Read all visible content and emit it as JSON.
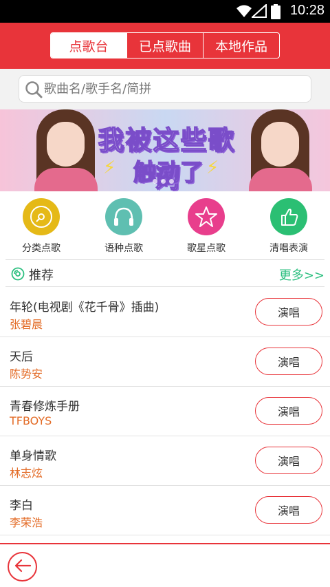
{
  "status_bar": {
    "time": "10:28"
  },
  "header": {
    "tabs": [
      {
        "label": "点歌台",
        "active": true
      },
      {
        "label": "已点歌曲",
        "active": false
      },
      {
        "label": "本地作品",
        "active": false
      }
    ]
  },
  "search": {
    "placeholder": "歌曲名/歌手名/简拼"
  },
  "banner": {
    "line1": "我被这些歌词",
    "line2": "触动了"
  },
  "categories": [
    {
      "label": "分类点歌",
      "icon": "disc-icon",
      "color": "#e5b917"
    },
    {
      "label": "语种点歌",
      "icon": "headphones-icon",
      "color": "#5fbfb1"
    },
    {
      "label": "歌星点歌",
      "icon": "star-icon",
      "color": "#e83e8c"
    },
    {
      "label": "清唱表演",
      "icon": "thumbs-up-icon",
      "color": "#2bbf73"
    }
  ],
  "recommend": {
    "title": "推荐",
    "more": "更多>>"
  },
  "songs": [
    {
      "title": "年轮(电视剧《花千骨》插曲)",
      "artist": "张碧晨",
      "button": "演唱"
    },
    {
      "title": "天后",
      "artist": "陈势安",
      "button": "演唱"
    },
    {
      "title": "青春修炼手册",
      "artist": "TFBOYS",
      "button": "演唱"
    },
    {
      "title": "单身情歌",
      "artist": "林志炫",
      "button": "演唱"
    },
    {
      "title": "李白",
      "artist": "李荣浩",
      "button": "演唱"
    }
  ],
  "colors": {
    "accent": "#e8343a",
    "artist": "#e36b26",
    "more": "#2bbf7f"
  }
}
